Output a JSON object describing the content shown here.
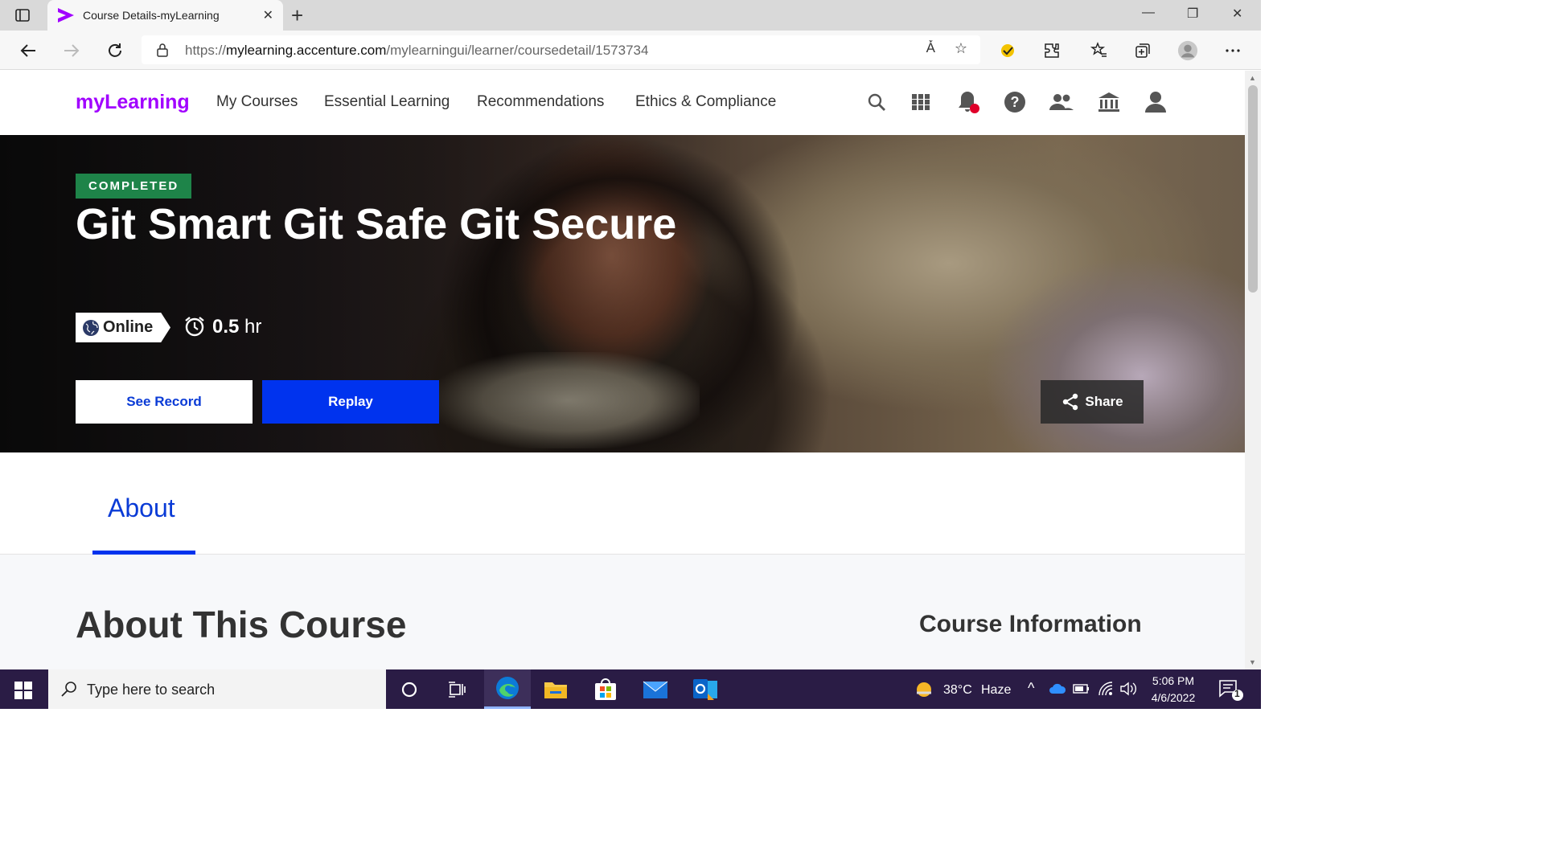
{
  "browser": {
    "tab_title": "Course Details-myLearning",
    "url_prefix": "https://",
    "url_domain": "mylearning.accenture.com",
    "url_path": "/mylearningui/learner/coursedetail/1573734",
    "read_aloud_label": "Á̀"
  },
  "nav": {
    "brand": "myLearning",
    "links": [
      "My Courses",
      "Essential Learning",
      "Recommendations",
      "Ethics & Compliance"
    ],
    "icons": [
      "search-icon",
      "apps-grid-icon",
      "bell-icon",
      "help-icon",
      "people-icon",
      "institution-icon",
      "profile-icon"
    ]
  },
  "hero": {
    "status_badge": "COMPLETED",
    "title": "Git Smart Git Safe Git Secure",
    "delivery": "Online",
    "duration_value": "0.5",
    "duration_unit": "hr",
    "see_record_label": "See Record",
    "replay_label": "Replay",
    "share_label": "Share"
  },
  "tabs": {
    "about_label": "About"
  },
  "content": {
    "about_heading": "About This Course",
    "info_heading": "Course Information"
  },
  "taskbar": {
    "search_placeholder": "Type here to search",
    "temperature": "38°C",
    "weather": "Haze",
    "time": "5:06 PM",
    "date": "4/6/2022",
    "notification_count": "1"
  },
  "colors": {
    "brand": "#a100ff",
    "primary": "#0033ee",
    "completed": "#1e8449",
    "notification_dot": "#e0002a"
  }
}
